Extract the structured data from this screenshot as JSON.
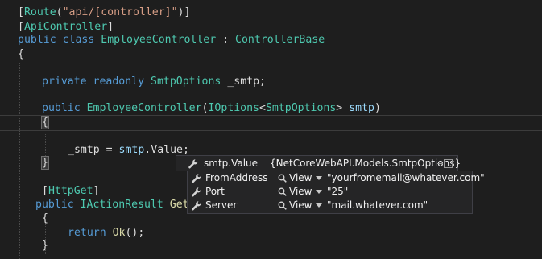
{
  "code": {
    "line1": {
      "open": "[",
      "attr": "Route",
      "p1": "(",
      "str": "\"api/[controller]\"",
      "p2": ")]"
    },
    "line2": {
      "open": "[",
      "attr": "ApiController",
      "close": "]"
    },
    "line3": {
      "kw1": "public",
      "kw2": "class",
      "name": "EmployeeController",
      "colon": " : ",
      "base": "ControllerBase"
    },
    "line4": {
      "brace": "{"
    },
    "line6": {
      "kw1": "private",
      "kw2": "readonly",
      "type": "SmtpOptions",
      "field": "_smtp",
      "semi": ";"
    },
    "line8": {
      "kw": "public",
      "name": "EmployeeController",
      "p1": "(",
      "iface": "IOptions",
      "lt": "<",
      "gtype": "SmtpOptions",
      "gt": ">",
      "param": "smtp",
      "p2": ")"
    },
    "line9": {
      "brace": "{"
    },
    "line11": {
      "field": "_smtp",
      "eq": " = ",
      "param": "smtp",
      "dot": ".",
      "prop": "Value",
      "semi": ";"
    },
    "line12": {
      "brace": "}"
    },
    "line14": {
      "open": "[",
      "attr": "HttpGet",
      "close": "]"
    },
    "line15": {
      "kw": "public",
      "type": "IActionResult",
      "name": "GetE"
    },
    "line16": {
      "brace": "{"
    },
    "line17": {
      "kw": "return",
      "meth": "Ok",
      "rest": "();"
    },
    "line18": {
      "brace": "}"
    }
  },
  "datatip": {
    "header": {
      "name": "smtp.Value",
      "value": "{NetCoreWebAPI.Models.SmtpOptions}"
    },
    "rows": [
      {
        "name": "FromAddress",
        "view": "View",
        "value": "\"yourfromemail@whatever.com\""
      },
      {
        "name": "Port",
        "view": "View",
        "value": "\"25\""
      },
      {
        "name": "Server",
        "view": "View",
        "value": "\"mail.whatever.com\""
      }
    ]
  },
  "colors": {
    "background": "#1e1e1e",
    "keyword": "#569cd6",
    "type": "#4ec9b0",
    "string": "#d69d85",
    "method": "#dcdcaa",
    "parameter": "#9cdcfe",
    "tooltip_bg": "#252526"
  },
  "icons": [
    "wrench-icon",
    "magnifier-icon",
    "dropdown-arrow-icon",
    "pin-icon"
  ]
}
